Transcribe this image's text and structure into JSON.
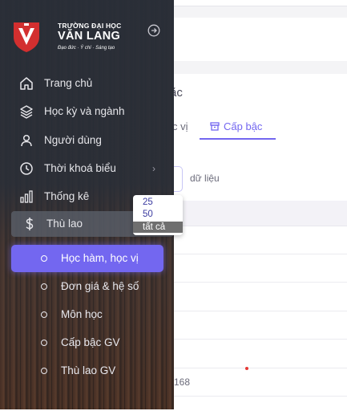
{
  "university": {
    "line1": "TRƯỜNG ĐẠI HỌC",
    "line2": "VĂN LANG",
    "slogan": "Đạo đức · Ý chí · Sáng tạo"
  },
  "sidebar": {
    "items": [
      {
        "label": "Trang chủ",
        "icon": "home-icon"
      },
      {
        "label": "Học kỳ và ngành",
        "icon": "layers-icon"
      },
      {
        "label": "Người dùng",
        "icon": "user-icon"
      },
      {
        "label": "Thời khoá biểu",
        "icon": "clock-icon",
        "chevron": "›"
      },
      {
        "label": "Thống kê",
        "icon": "bar-chart-icon"
      },
      {
        "label": "Thù lao",
        "icon": "dollar-icon"
      }
    ],
    "subitems": [
      {
        "label": "Học hàm, học vị",
        "active": true
      },
      {
        "label": "Đơn giá & hệ số"
      },
      {
        "label": "Môn học"
      },
      {
        "label": "Cấp bậc GV"
      },
      {
        "label": "Thù lao GV"
      }
    ]
  },
  "main": {
    "card_title_fragment": "ặc",
    "tabs": [
      {
        "label": "c vị"
      },
      {
        "label": "Cấp bậc",
        "active": true
      }
    ],
    "data_label": "dữ liệu",
    "cell_value": "168"
  },
  "page_size_dropdown": {
    "options": [
      "25",
      "50",
      "tất cả"
    ],
    "selected": "tất cả"
  },
  "colors": {
    "accent": "#7367f0",
    "sidebar_bg": "#283038",
    "brand_red": "#d32f2f"
  }
}
